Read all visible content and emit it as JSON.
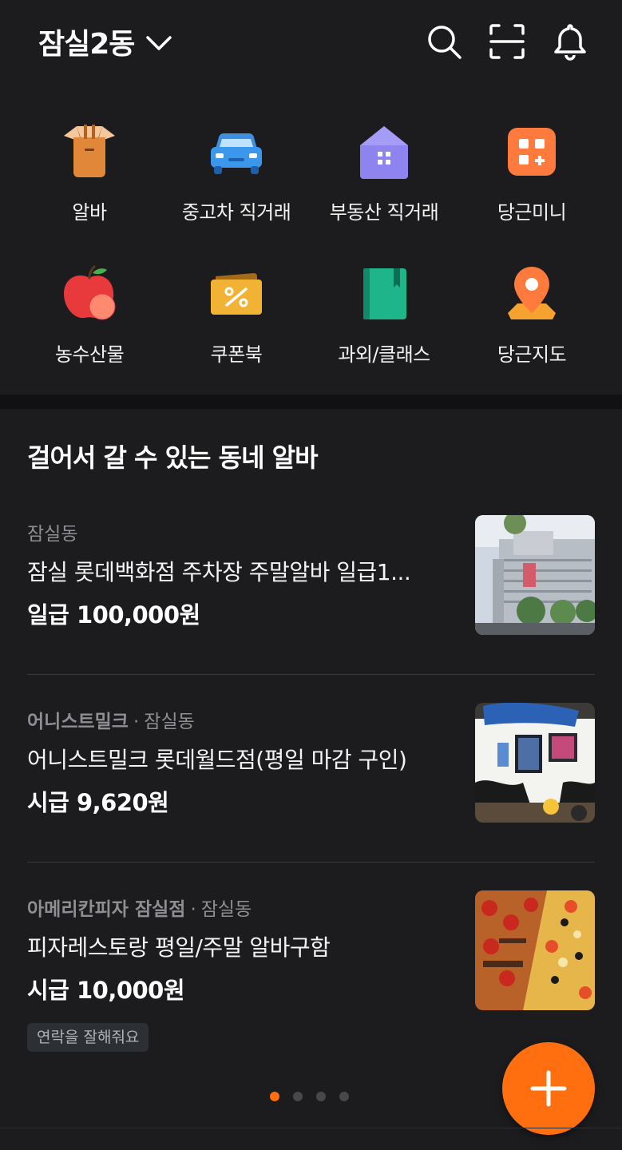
{
  "header": {
    "location": "잠실2동"
  },
  "categories": [
    {
      "label": "알바",
      "icon": "apron-icon"
    },
    {
      "label": "중고차 직거래",
      "icon": "car-icon"
    },
    {
      "label": "부동산 직거래",
      "icon": "house-icon"
    },
    {
      "label": "당근미니",
      "icon": "mini-apps-icon"
    },
    {
      "label": "농수산물",
      "icon": "apple-icon"
    },
    {
      "label": "쿠폰북",
      "icon": "coupon-icon"
    },
    {
      "label": "과외/클래스",
      "icon": "book-icon"
    },
    {
      "label": "당근지도",
      "icon": "map-pin-icon"
    }
  ],
  "section": {
    "title": "걸어서 갈 수 있는 동네 알바"
  },
  "jobs": [
    {
      "company": "",
      "location": "잠실동",
      "title": "잠실 롯데백화점 주차장 주말알바 일급1...",
      "pay": "일급 100,000원"
    },
    {
      "company": "어니스트밀크",
      "separator": "·",
      "location": "잠실동",
      "title": "어니스트밀크 롯데월드점(평일 마감 구인)",
      "pay": "시급 9,620원"
    },
    {
      "company": "아메리칸피자 잠실점",
      "separator": "·",
      "location": "잠실동",
      "title": "피자레스토랑 평일/주말 알바구함",
      "pay": "시급 10,000원",
      "tag": "연락을 잘해줘요"
    }
  ],
  "pagination": {
    "total": 4,
    "active": 1
  },
  "colors": {
    "background": "#1c1c1e",
    "accent": "#ff6f0f",
    "muted_text": "#8e8e93"
  }
}
